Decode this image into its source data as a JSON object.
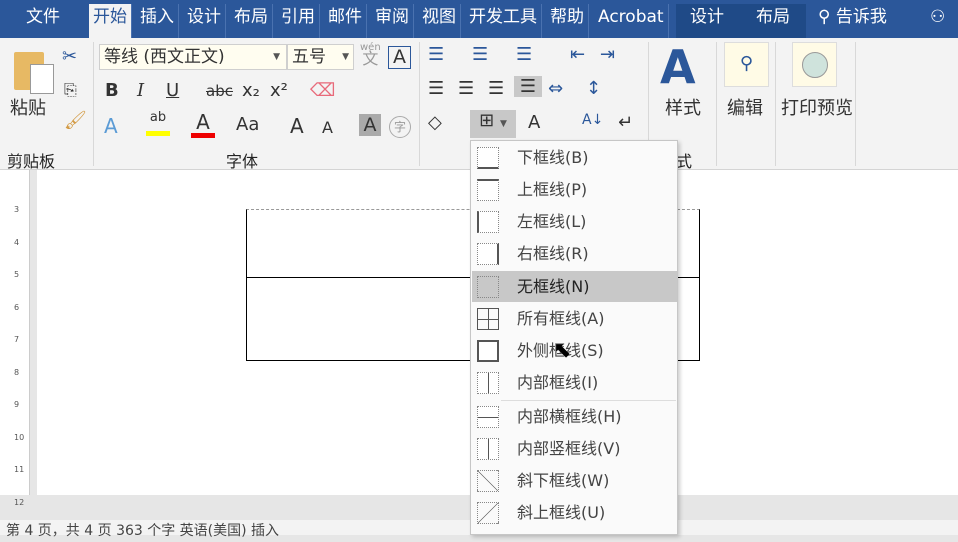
{
  "tabs": [
    "文件",
    "开始",
    "插入",
    "设计",
    "布局",
    "引用",
    "邮件",
    "审阅",
    "视图",
    "开发工具",
    "帮助",
    "Acrobat"
  ],
  "context_tabs": [
    "设计",
    "布局"
  ],
  "tell_me": "告诉我",
  "clipboard": {
    "paste": "粘贴",
    "group": "剪贴板"
  },
  "font": {
    "name": "等线 (西文正文)",
    "size": "五号",
    "group": "字体",
    "wen": "wén",
    "wen_char": "文",
    "box_a": "A",
    "bold": "B",
    "italic": "I",
    "underline": "U",
    "strike": "abc",
    "sub": "x₂",
    "sup": "x²",
    "case": "Aa",
    "grow": "A",
    "shrink": "A",
    "shade": "A",
    "enclose": "字"
  },
  "styles": {
    "label": "样式",
    "group_partial": "式"
  },
  "editing": {
    "label": "编辑"
  },
  "print_preview": {
    "label": "打印预览"
  },
  "border_menu": {
    "items": [
      {
        "label": "下框线(B)"
      },
      {
        "label": "上框线(P)"
      },
      {
        "label": "左框线(L)"
      },
      {
        "label": "右框线(R)"
      },
      {
        "label": "无框线(N)",
        "highlighted": true
      },
      {
        "label": "所有框线(A)"
      },
      {
        "label": "外侧框线(S)"
      },
      {
        "label": "内部框线(I)"
      },
      {
        "label": "内部横框线(H)"
      },
      {
        "label": "内部竖框线(V)"
      },
      {
        "label": "斜下框线(W)"
      },
      {
        "label": "斜上框线(U)"
      }
    ]
  },
  "ruler": [
    "3",
    "4",
    "5",
    "6",
    "7",
    "8",
    "9",
    "10",
    "11",
    "12"
  ],
  "status": "第 4 页，共 4 页    363 个字    英语(美国)    插入"
}
